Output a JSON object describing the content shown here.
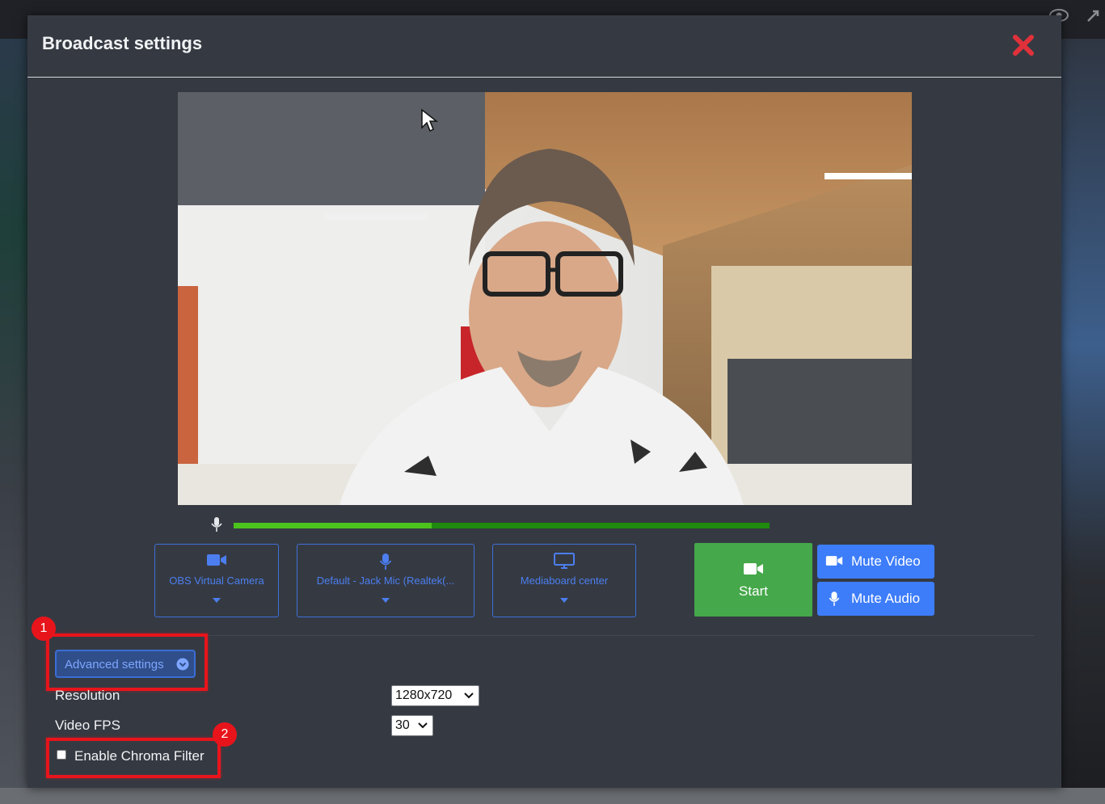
{
  "modal": {
    "title": "Broadcast settings"
  },
  "audio_meter": {
    "level_fraction": 0.37
  },
  "devices": {
    "camera_label": "OBS Virtual Camera",
    "mic_label": "Default - Jack Mic (Realtek(...",
    "screen_label": "Mediaboard center"
  },
  "controls": {
    "start_label": "Start",
    "mute_video_label": "Mute Video",
    "mute_audio_label": "Mute Audio"
  },
  "advanced": {
    "toggle_label": "Advanced settings",
    "resolution_label": "Resolution",
    "resolution_value": "1280x720",
    "fps_label": "Video FPS",
    "fps_value": "30",
    "chroma_label": "Enable Chroma Filter",
    "chroma_checked": false
  },
  "annotations": {
    "step1": "1",
    "step2": "2"
  },
  "colors": {
    "modal_bg": "#353a42",
    "accent_blue": "#3d7dfa",
    "start_green": "#45a84a",
    "meter_green": "#4cc21c",
    "close_red": "#e0313b",
    "annotation_red": "#e8141b"
  }
}
